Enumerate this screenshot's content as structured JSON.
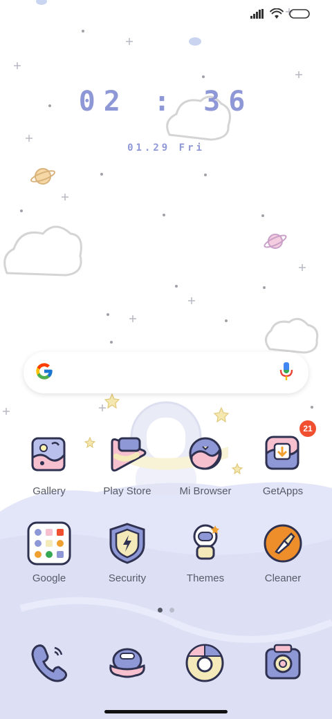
{
  "status_bar": {
    "signal_icon": "signal-bars-icon",
    "wifi_icon": "wifi-icon",
    "battery_icon": "battery-icon"
  },
  "clock": {
    "time": "02 : 36",
    "date": "01.29 Fri"
  },
  "search": {
    "google_icon": "google-g-icon",
    "mic_icon": "microphone-icon"
  },
  "apps_row1": [
    {
      "label": "Gallery",
      "icon": "gallery-icon"
    },
    {
      "label": "Play Store",
      "icon": "play-store-icon"
    },
    {
      "label": "Mi Browser",
      "icon": "mi-browser-icon"
    },
    {
      "label": "GetApps",
      "icon": "getapps-icon",
      "badge": "21"
    }
  ],
  "apps_row2": [
    {
      "label": "Google",
      "icon": "google-folder-icon"
    },
    {
      "label": "Security",
      "icon": "security-shield-icon"
    },
    {
      "label": "Themes",
      "icon": "themes-astronaut-icon"
    },
    {
      "label": "Cleaner",
      "icon": "cleaner-brush-icon"
    }
  ],
  "dock": [
    {
      "icon": "phone-icon"
    },
    {
      "icon": "messages-icon"
    },
    {
      "icon": "chrome-icon"
    },
    {
      "icon": "camera-icon"
    }
  ],
  "colors": {
    "clock": "#8f98d6",
    "badge": "#f0502f",
    "label": "#555a66",
    "wallpaper_ground": "#dde0f6"
  }
}
